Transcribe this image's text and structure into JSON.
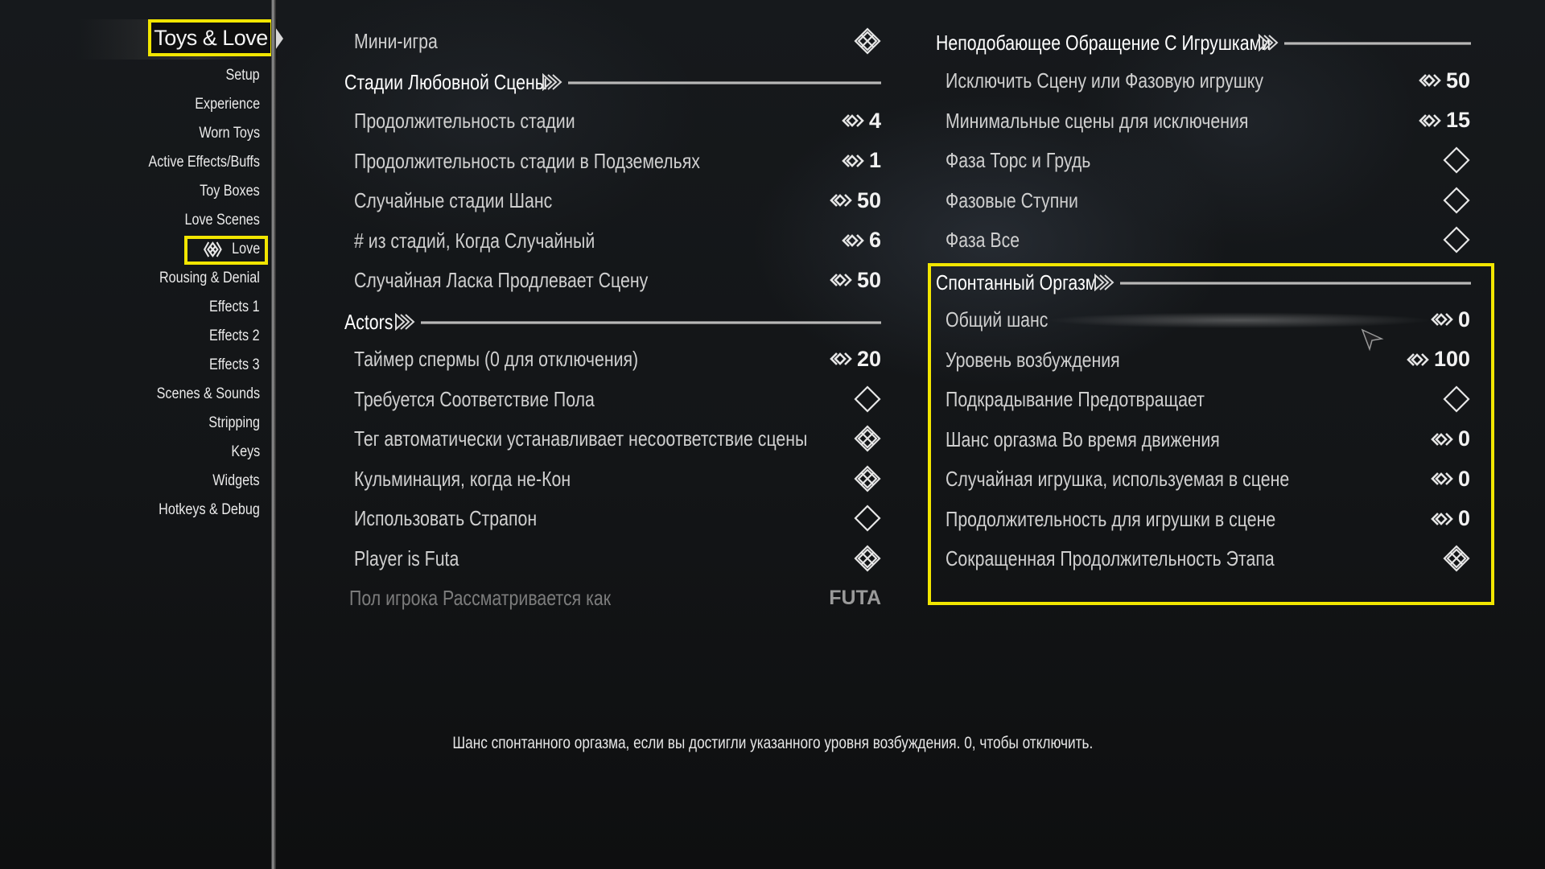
{
  "nav": {
    "title": "Toys & Love",
    "items": [
      {
        "label": "Setup"
      },
      {
        "label": "Experience"
      },
      {
        "label": "Worn Toys"
      },
      {
        "label": "Active Effects/Buffs"
      },
      {
        "label": "Toy Boxes"
      },
      {
        "label": "Love Scenes"
      },
      {
        "label": "Love",
        "active": true
      },
      {
        "label": "Rousing & Denial"
      },
      {
        "label": "Effects 1"
      },
      {
        "label": "Effects 2"
      },
      {
        "label": "Effects 3"
      },
      {
        "label": "Scenes & Sounds"
      },
      {
        "label": "Stripping"
      },
      {
        "label": "Keys"
      },
      {
        "label": "Widgets"
      },
      {
        "label": "Hotkeys & Debug"
      }
    ]
  },
  "left": {
    "minigame": {
      "label": "Мини-игра",
      "icon": "toggle-on-icon"
    },
    "stages_header": "Стадии Любовной Сцены",
    "stages": [
      {
        "label": "Продолжительность стадии",
        "value": "4"
      },
      {
        "label": "Продолжительность стадии в Подземельях",
        "value": "1"
      },
      {
        "label": "Случайные стадии Шанс",
        "value": "50"
      },
      {
        "label": "# из стадий, Когда Случайный",
        "value": "6"
      },
      {
        "label": "Случайная Ласка Продлевает Сцену",
        "value": "50"
      }
    ],
    "actors_header": "Actors",
    "actors": [
      {
        "label": "Таймер спермы (0 для отключения)",
        "value": "20",
        "kind": "slider"
      },
      {
        "label": "Требуется Соответствие Пола",
        "kind": "toggle",
        "on": false
      },
      {
        "label": "Тег автоматически устанавливает несоответствие сцены",
        "kind": "toggle",
        "on": true
      },
      {
        "label": "Кульминация, когда не-Кон",
        "kind": "toggle",
        "on": true
      },
      {
        "label": "Использовать Страпон",
        "kind": "toggle",
        "on": false
      },
      {
        "label": "Player is Futa",
        "kind": "toggle",
        "on": true
      },
      {
        "label": "Пол игрока Рассматривается как",
        "value": "FUTA",
        "kind": "text",
        "disabled": true
      }
    ]
  },
  "right": {
    "toys_header": "Неподобающее Обращение С Игрушками",
    "toys": [
      {
        "label": "Исключить Сцену или Фазовую игрушку",
        "value": "50",
        "kind": "slider"
      },
      {
        "label": "Минимальные сцены для исключения",
        "value": "15",
        "kind": "slider"
      },
      {
        "label": "Фаза Торс и Грудь",
        "kind": "toggle",
        "on": false
      },
      {
        "label": "Фазовые Ступни",
        "kind": "toggle",
        "on": false
      },
      {
        "label": "Фаза Все",
        "kind": "toggle",
        "on": false
      }
    ],
    "orgasm_header": "Спонтанный Оргазм",
    "orgasm": [
      {
        "label": "Общий шанс",
        "value": "0",
        "kind": "slider"
      },
      {
        "label": "Уровень возбуждения",
        "value": "100",
        "kind": "slider"
      },
      {
        "label": "Подкрадывание Предотвращает",
        "kind": "toggle",
        "on": false
      },
      {
        "label": "Шанс оргазма Во время движения",
        "value": "0",
        "kind": "slider"
      },
      {
        "label": "Случайная игрушка, используемая в сцене",
        "value": "0",
        "kind": "slider"
      },
      {
        "label": "Продолжительность для игрушки в сцене",
        "value": "0",
        "kind": "slider"
      },
      {
        "label": "Сокращенная Продолжительность Этапа",
        "kind": "toggle",
        "on": true
      }
    ]
  },
  "description": "Шанс спонтанного оргазма, если вы достигли указанного уровня возбуждения. 0, чтобы отключить.",
  "colors": {
    "highlight": "#f2e600",
    "text": "#cfcfcf",
    "header": "#ffffff"
  }
}
